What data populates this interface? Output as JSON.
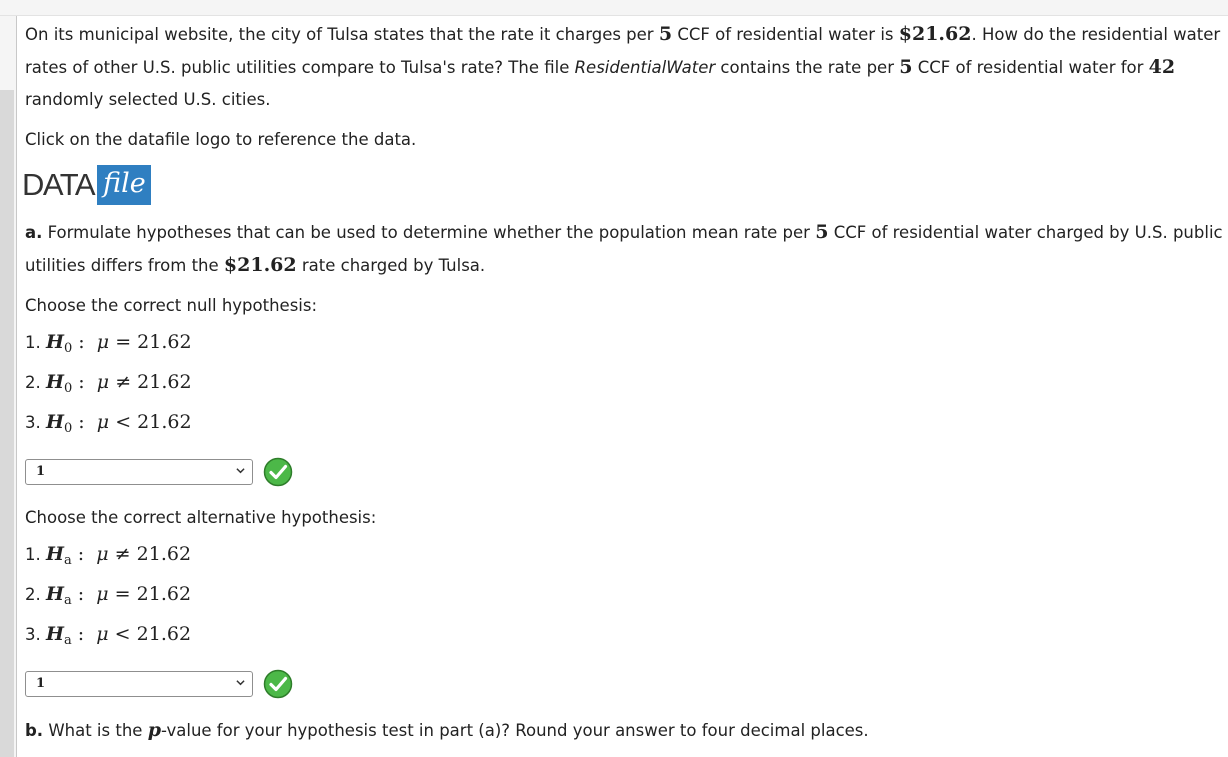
{
  "intro": {
    "t1": "On its municipal website, the city of Tulsa states that the rate it charges per ",
    "n5a": "5",
    "t2": " CCF of residential water is ",
    "price1": "$21.62",
    "t3": ". How do the residential water rates of other U.S. public utilities compare to Tulsa's rate? The file ",
    "file": "ResidentialWater",
    "t4": " contains the rate per ",
    "n5b": "5",
    "t5": " CCF of residential water for ",
    "n42": "42",
    "t6": " randomly selected U.S. cities."
  },
  "click_text": "Click on the datafile logo to reference the data.",
  "logo": {
    "data": "DATA",
    "file": "file"
  },
  "part_a": {
    "label": "a.",
    "t1": " Formulate hypotheses that can be used to determine whether the population mean rate per ",
    "n5": "5",
    "t2": " CCF of residential water charged by U.S. public utilities differs from the ",
    "price": "$21.62",
    "t3": " rate charged by Tulsa."
  },
  "null_section": {
    "prompt": "Choose the correct null hypothesis:",
    "options": [
      {
        "num": "1.",
        "h": "H",
        "sub": "0",
        "colon": ":",
        "mu": "μ",
        "op": "=",
        "val": "21.62"
      },
      {
        "num": "2.",
        "h": "H",
        "sub": "0",
        "colon": ":",
        "mu": "μ",
        "op": "≠",
        "val": "21.62"
      },
      {
        "num": "3.",
        "h": "H",
        "sub": "0",
        "colon": ":",
        "mu": "μ",
        "op": "<",
        "val": "21.62"
      }
    ],
    "selected": "1"
  },
  "alt_section": {
    "prompt": "Choose the correct alternative hypothesis:",
    "options": [
      {
        "num": "1.",
        "h": "H",
        "sub": "a",
        "colon": ":",
        "mu": "μ",
        "op": "≠",
        "val": "21.62"
      },
      {
        "num": "2.",
        "h": "H",
        "sub": "a",
        "colon": ":",
        "mu": "μ",
        "op": "=",
        "val": "21.62"
      },
      {
        "num": "3.",
        "h": "H",
        "sub": "a",
        "colon": ":",
        "mu": "μ",
        "op": "<",
        "val": "21.62"
      }
    ],
    "selected": "1"
  },
  "part_b": {
    "label": "b.",
    "t1": " What is the ",
    "p": "p",
    "t2": "-value for your hypothesis test in part (a)? Round your answer to four decimal places."
  },
  "colors": {
    "check_green": "#4cb848",
    "logo_blue": "#2f7fc1"
  }
}
